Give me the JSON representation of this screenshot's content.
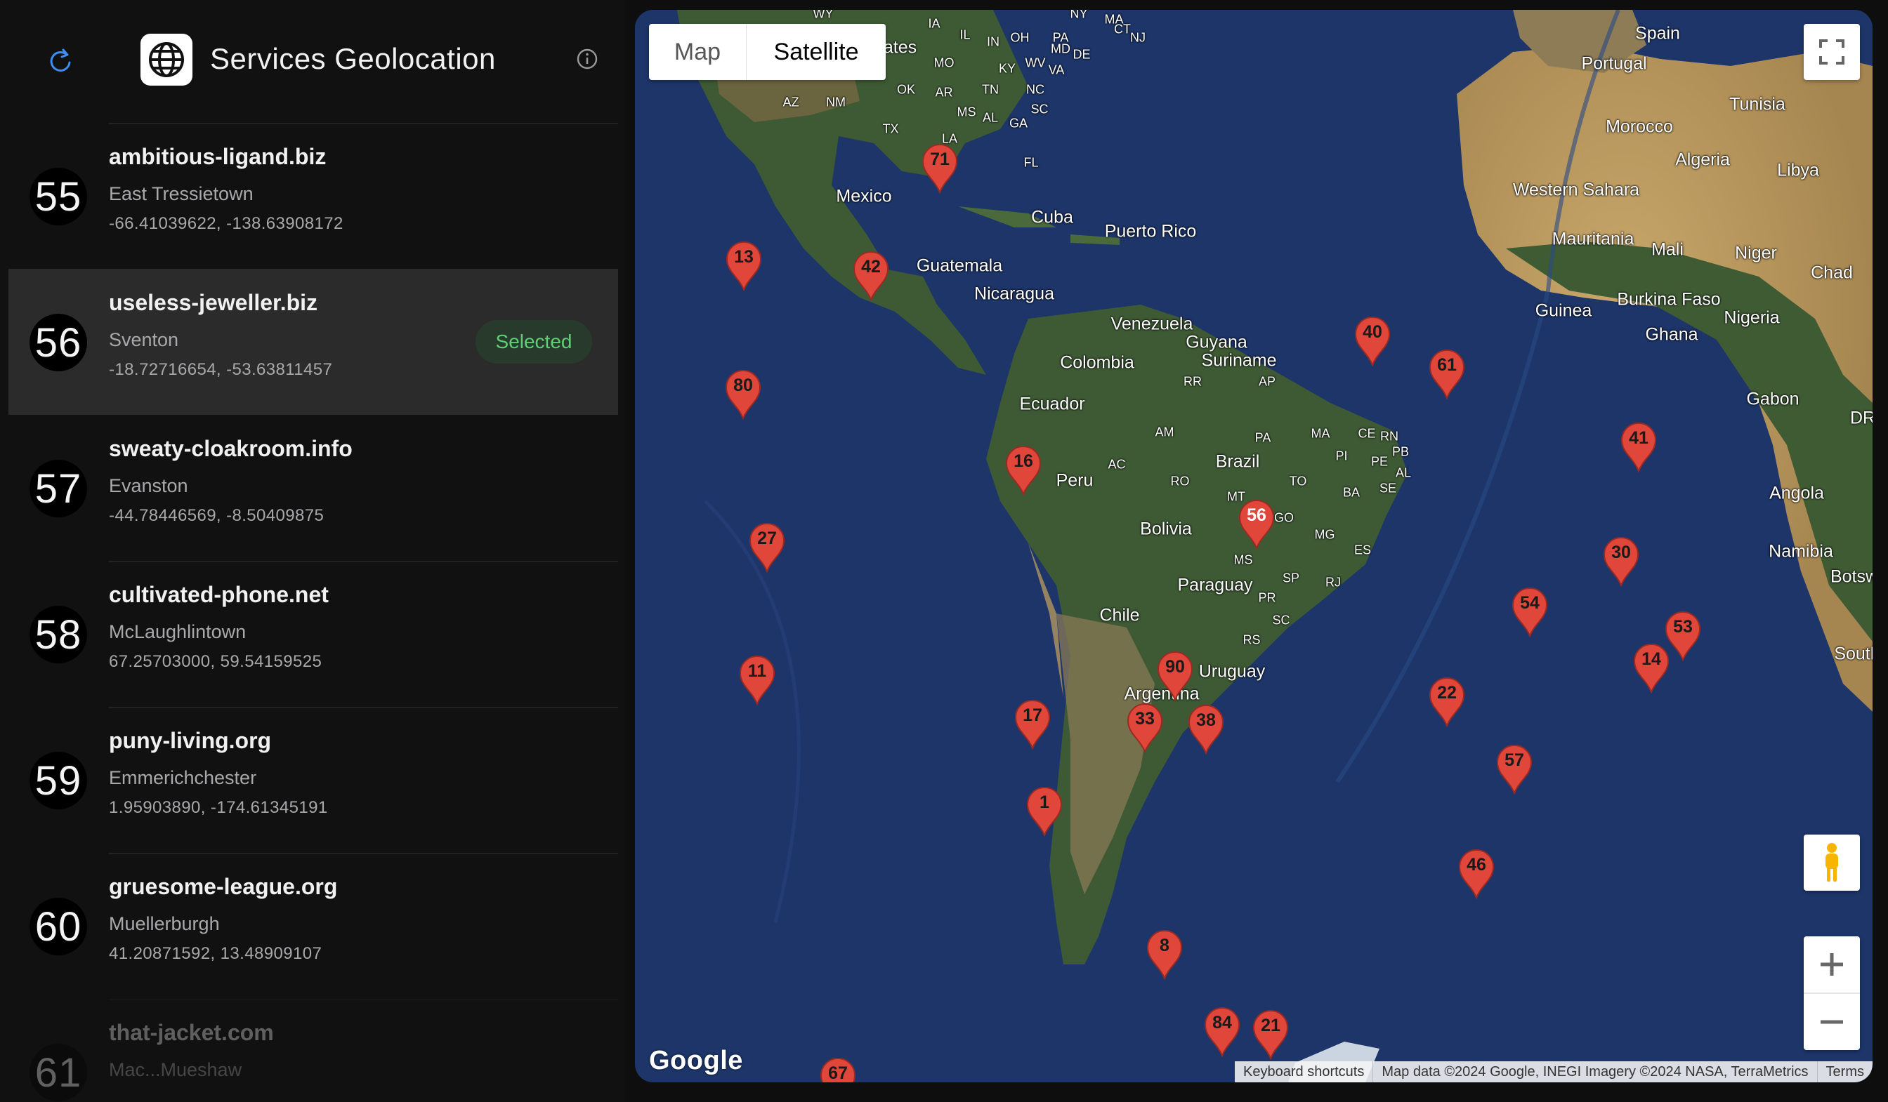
{
  "app": {
    "title": "Services Geolocation"
  },
  "services": [
    {
      "number": "55",
      "domain": "ambitious-ligand.biz",
      "city": "East Tressietown",
      "coords": "-66.41039622, -138.63908172",
      "selected": false
    },
    {
      "number": "56",
      "domain": "useless-jeweller.biz",
      "city": "Sventon",
      "coords": "-18.72716654, -53.63811457",
      "selected": true,
      "status": "Selected"
    },
    {
      "number": "57",
      "domain": "sweaty-cloakroom.info",
      "city": "Evanston",
      "coords": "-44.78446569, -8.50409875",
      "selected": false
    },
    {
      "number": "58",
      "domain": "cultivated-phone.net",
      "city": "McLaughlintown",
      "coords": "67.25703000, 59.54159525",
      "selected": false
    },
    {
      "number": "59",
      "domain": "puny-living.org",
      "city": "Emmerichchester",
      "coords": "1.95903890, -174.61345191",
      "selected": false
    },
    {
      "number": "60",
      "domain": "gruesome-league.org",
      "city": "Muellerburgh",
      "coords": "41.20871592, 13.48909107",
      "selected": false
    },
    {
      "number": "61",
      "domain": "that-jacket.com",
      "city": "Mac...Mueshaw",
      "coords": "",
      "selected": false
    }
  ],
  "map": {
    "type_buttons": {
      "map": "Map",
      "satellite": "Satellite"
    },
    "active_type": "Satellite",
    "google": "Google",
    "attribution": {
      "shortcuts": "Keyboard shortcuts",
      "data": "Map data ©2024 Google, INEGI Imagery ©2024 NASA, TerraMetrics",
      "terms": "Terms"
    },
    "markers": [
      "71",
      "13",
      "42",
      "80",
      "40",
      "61",
      "16",
      "56",
      "27",
      "11",
      "90",
      "17",
      "33",
      "38",
      "1",
      "8",
      "84",
      "21",
      "67",
      "22",
      "57",
      "46",
      "54",
      "30",
      "41",
      "14",
      "53"
    ],
    "place_labels": [
      "Spain",
      "Portugal",
      "Morocco",
      "Tunisia",
      "Algeria",
      "Libya",
      "Western Sahara",
      "Mauritania",
      "Mali",
      "Niger",
      "Chad",
      "Burkina Faso",
      "Guinea",
      "Ghana",
      "Nigeria",
      "Gabon",
      "Angola",
      "Namibia",
      "Botsw",
      "South",
      "DR",
      "Mexico",
      "Cuba",
      "Puerto Rico",
      "Guatemala",
      "Nicaragua",
      "Venezuela",
      "Guyana",
      "Suriname",
      "Colombia",
      "Ecuador",
      "Peru",
      "Brazil",
      "Bolivia",
      "Paraguay",
      "Chile",
      "Uruguay",
      "Argentina",
      "tates"
    ],
    "state_labels": [
      "WY",
      "IA",
      "NY",
      "MA",
      "IL",
      "IN",
      "OH",
      "PA",
      "MD",
      "DE",
      "CT",
      "NJ",
      "MO",
      "KY",
      "WV",
      "VA",
      "OK",
      "AR",
      "TN",
      "NC",
      "AZ",
      "NM",
      "MS",
      "AL",
      "GA",
      "SC",
      "TX",
      "LA",
      "FL",
      "RR",
      "AP",
      "AM",
      "PA",
      "MA",
      "CE",
      "RN",
      "PB",
      "PI",
      "PE",
      "AL",
      "AC",
      "RO",
      "TO",
      "SE",
      "BA",
      "MT",
      "GO",
      "MG",
      "MS",
      "ES",
      "SP",
      "RJ",
      "PR",
      "SC",
      "RS"
    ],
    "colors": {
      "pin": "#e0473a",
      "ocean": "#1d3569",
      "land": "#3d5a34",
      "selected_text": "#5fcf76"
    }
  }
}
